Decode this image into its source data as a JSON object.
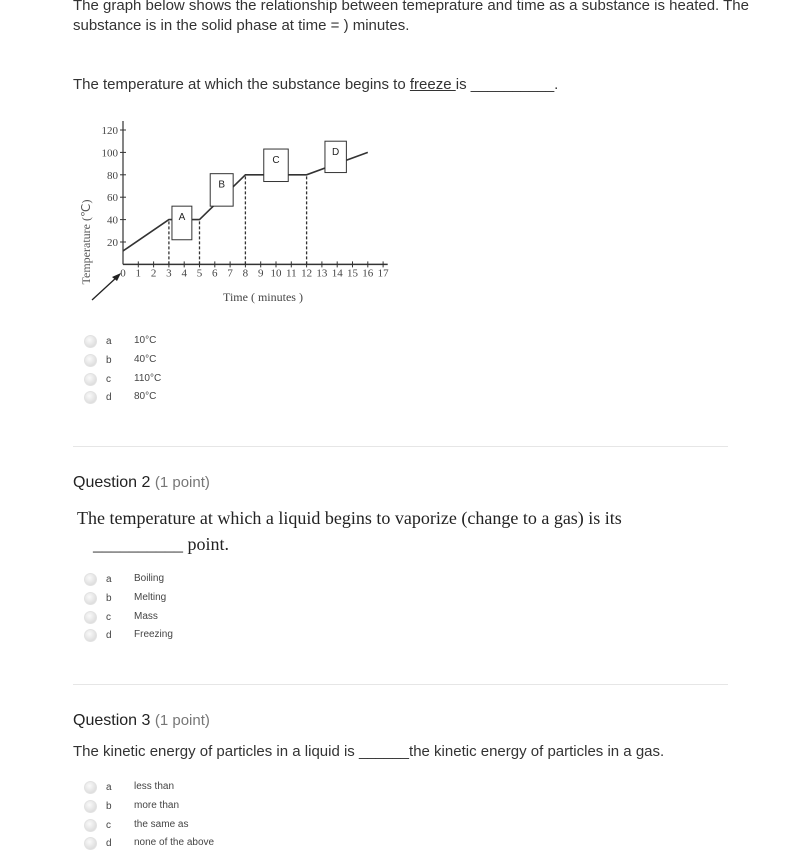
{
  "question1": {
    "intro": "The graph below shows the relationship between temeprature and time as a substance is heated.  The substance is in the solid phase at time = ) minutes.",
    "prompt_before": "The temperature at which the substance begins to ",
    "prompt_link": "freeze ",
    "prompt_after": "is __________.",
    "options": [
      {
        "letter": "a",
        "text": "10°C"
      },
      {
        "letter": "b",
        "text": "40°C"
      },
      {
        "letter": "c",
        "text": "110°C"
      },
      {
        "letter": "d",
        "text": "80°C"
      }
    ]
  },
  "chart_data": {
    "type": "line",
    "xlabel": "Time ( minutes )",
    "ylabel": "Temperature (℃)",
    "xlim": [
      0,
      17
    ],
    "ylim": [
      0,
      120
    ],
    "x_ticks": [
      "0",
      "1",
      "2",
      "3",
      "4",
      "5",
      "6",
      "7",
      "8",
      "9",
      "10",
      "11",
      "12",
      "13",
      "14",
      "15",
      "16",
      "17"
    ],
    "y_ticks": [
      "20",
      "40",
      "60",
      "80",
      "100",
      "120"
    ],
    "series": [
      {
        "x": [
          0,
          3,
          5,
          8,
          12,
          16
        ],
        "y": [
          12,
          40,
          40,
          80,
          80,
          100
        ]
      }
    ],
    "dashed_markers": [
      {
        "t": 3,
        "temp": 40
      },
      {
        "t": 5,
        "temp": 40
      },
      {
        "t": 8,
        "temp": 80
      },
      {
        "t": 12,
        "temp": 80
      }
    ],
    "region_labels": [
      {
        "label": "A",
        "t": [
          3.2,
          4.5
        ],
        "temp": [
          22,
          52
        ]
      },
      {
        "label": "B",
        "t": [
          5.7,
          7.2
        ],
        "temp": [
          52,
          81
        ]
      },
      {
        "label": "C",
        "t": [
          9.2,
          10.8
        ],
        "temp": [
          74,
          103
        ]
      },
      {
        "label": "D",
        "t": [
          13.2,
          14.6
        ],
        "temp": [
          82,
          110
        ]
      }
    ]
  },
  "question2": {
    "heading": "Question 2",
    "points": "(1 point)",
    "line1": "The temperature at which a liquid begins to vaporize (change to a gas) is its",
    "line2": "__________ point.",
    "options": [
      {
        "letter": "a",
        "text": "Boiling"
      },
      {
        "letter": "b",
        "text": "Melting"
      },
      {
        "letter": "c",
        "text": "Mass"
      },
      {
        "letter": "d",
        "text": "Freezing"
      }
    ]
  },
  "question3": {
    "heading": "Question 3",
    "points": "(1 point)",
    "body": "The kinetic energy of particles in a liquid is ______the kinetic energy of particles in a gas.",
    "options": [
      {
        "letter": "a",
        "text": "less than"
      },
      {
        "letter": "b",
        "text": "more than"
      },
      {
        "letter": "c",
        "text": "the same as"
      },
      {
        "letter": "d",
        "text": "none of the above"
      }
    ]
  }
}
